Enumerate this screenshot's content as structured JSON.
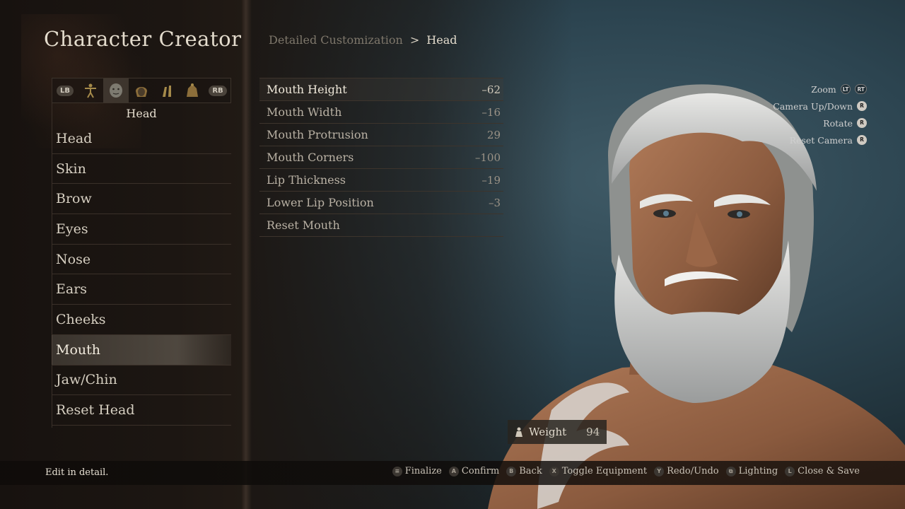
{
  "header": {
    "title": "Character Creator"
  },
  "breadcrumb": {
    "parent": "Detailed Customization",
    "separator": ">",
    "current": "Head"
  },
  "tabs": {
    "left_bumper": "LB",
    "right_bumper": "RB",
    "icons": [
      "body-icon",
      "face-icon",
      "hair-icon",
      "makeup-icon",
      "muscle-icon"
    ],
    "active_index": 1,
    "active_label": "Head"
  },
  "menu": {
    "items": [
      {
        "label": "Head"
      },
      {
        "label": "Skin"
      },
      {
        "label": "Brow"
      },
      {
        "label": "Eyes"
      },
      {
        "label": "Nose"
      },
      {
        "label": "Ears"
      },
      {
        "label": "Cheeks"
      },
      {
        "label": "Mouth"
      },
      {
        "label": "Jaw/Chin"
      },
      {
        "label": "Reset Head"
      }
    ],
    "selected_index": 7
  },
  "params": {
    "items": [
      {
        "label": "Mouth Height",
        "value": "–62"
      },
      {
        "label": "Mouth Width",
        "value": "–16"
      },
      {
        "label": "Mouth Protrusion",
        "value": "29"
      },
      {
        "label": "Mouth Corners",
        "value": "–100"
      },
      {
        "label": "Lip Thickness",
        "value": "–19"
      },
      {
        "label": "Lower Lip Position",
        "value": "–3"
      },
      {
        "label": "Reset Mouth",
        "value": ""
      }
    ],
    "selected_index": 0
  },
  "camera": {
    "zoom": {
      "label": "Zoom",
      "btn1": "LT",
      "btn2": "RT"
    },
    "updown": {
      "label": "Camera Up/Down",
      "btn": "R"
    },
    "rotate": {
      "label": "Rotate",
      "btn": "R"
    },
    "reset": {
      "label": "Reset Camera",
      "btn": "R"
    }
  },
  "weight": {
    "label": "Weight",
    "value": "94"
  },
  "footer": {
    "hint": "Edit in detail.",
    "actions": [
      {
        "icon": "≡",
        "label": "Finalize"
      },
      {
        "icon": "A",
        "label": "Confirm"
      },
      {
        "icon": "B",
        "label": "Back"
      },
      {
        "icon": "X",
        "label": "Toggle Equipment"
      },
      {
        "icon": "Y",
        "label": "Redo/Undo"
      },
      {
        "icon": "⧉",
        "label": "Lighting"
      },
      {
        "icon": "L",
        "label": "Close & Save"
      }
    ]
  },
  "colors": {
    "accent": "#e4dccd",
    "panel": "#1c1612",
    "scene": "#2c4450"
  }
}
